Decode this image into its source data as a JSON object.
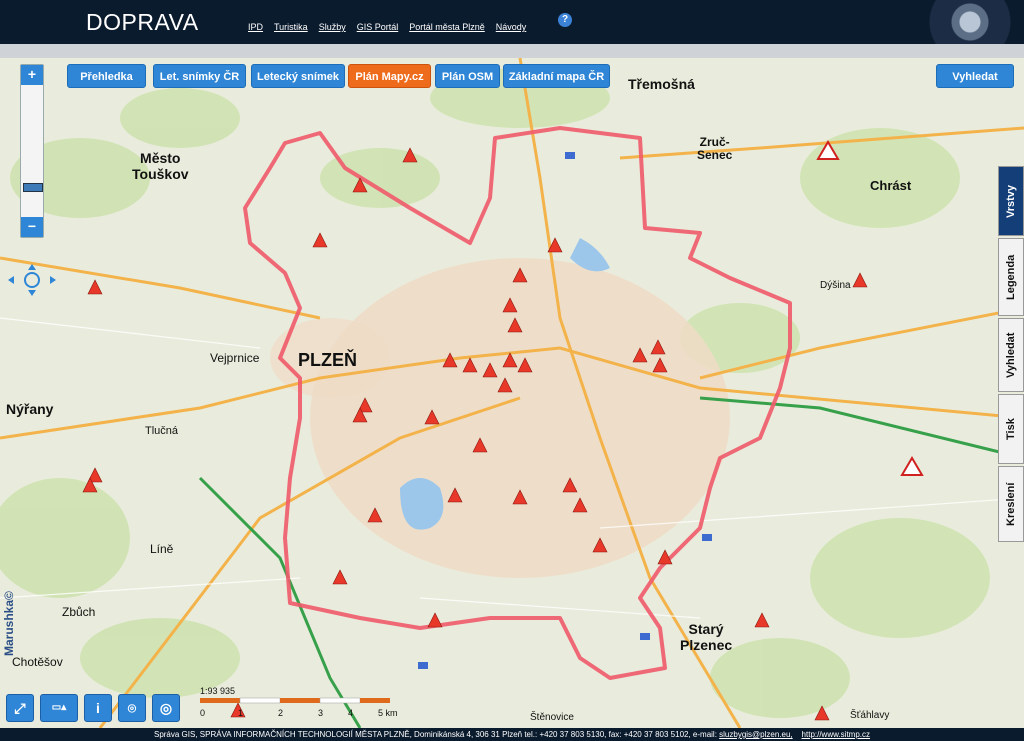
{
  "header": {
    "title": "DOPRAVA",
    "nav": [
      "IPD",
      "Turistika",
      "Služby",
      "GIS Portál",
      "Portál města Plzně",
      "Návody"
    ],
    "help_icon": "help-icon"
  },
  "map_buttons": {
    "prehledka": "Přehledka",
    "let_snimky": "Let. snímky ČR",
    "letecky_snimek": "Letecký snímek",
    "plan_mapy": "Plán Mapy.cz",
    "plan_osm": "Plán OSM",
    "zakladni_mapa": "Základní mapa ČR",
    "vyhledat": "Vyhledat",
    "active": "Plán Mapy.cz"
  },
  "side_tabs": [
    "Vrstvy",
    "Legenda",
    "Vyhledat",
    "Tisk",
    "Kreslení"
  ],
  "zoom": {
    "plus": "+",
    "minus": "−"
  },
  "place_labels": {
    "plzen": "PLZEŇ",
    "mesto_touskov": "Město\nTouškov",
    "nyrany": "Nýřany",
    "stary_plzenec": "Starý\nPlzenec",
    "tremosna": "Třemošná",
    "zruc_senec": "Zruč-\nSenec",
    "chrast": "Chrást",
    "vejprnice": "Vejprnice",
    "line": "Líně",
    "zbuch": "Zbůch",
    "chotesov": "Chotěšov",
    "tlucna": "Tlučná",
    "dysina": "Dýšina",
    "stahlavy": "Šťáhlavy",
    "stenovice": "Štěnovice"
  },
  "scale": {
    "ratio": "1:93 935",
    "ticks": [
      "0",
      "1",
      "2",
      "3",
      "4",
      "5 km"
    ]
  },
  "watermark": "Marushka©",
  "footer": {
    "text": "Správa GIS, SPRÁVA INFORMAČNÍCH TECHNOLOGIÍ MĚSTA PLZNĚ, Dominikánská 4, 306 31 Plzeň tel.: +420 37 803 5130, fax: +420 37 803 5102, e-mail:",
    "email": "sluzbygis@plzen.eu,",
    "url": "http://www.sitmp.cz"
  },
  "colors": {
    "accent": "#2f86d6",
    "active": "#ef6b1c",
    "boundary": "#ef5a6a",
    "header": "#0b1b2e"
  }
}
